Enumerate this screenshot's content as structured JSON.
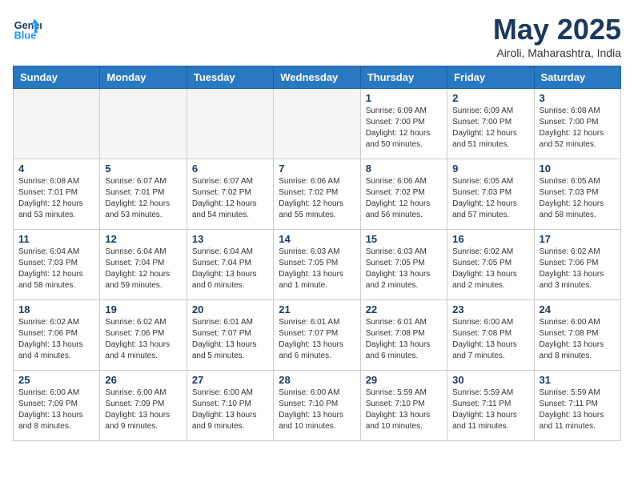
{
  "header": {
    "logo_line1": "General",
    "logo_line2": "Blue",
    "month": "May 2025",
    "location": "Airoli, Maharashtra, India"
  },
  "weekdays": [
    "Sunday",
    "Monday",
    "Tuesday",
    "Wednesday",
    "Thursday",
    "Friday",
    "Saturday"
  ],
  "weeks": [
    [
      {
        "day": "",
        "empty": true
      },
      {
        "day": "",
        "empty": true
      },
      {
        "day": "",
        "empty": true
      },
      {
        "day": "",
        "empty": true
      },
      {
        "day": "1",
        "info": "Sunrise: 6:09 AM\nSunset: 7:00 PM\nDaylight: 12 hours\nand 50 minutes."
      },
      {
        "day": "2",
        "info": "Sunrise: 6:09 AM\nSunset: 7:00 PM\nDaylight: 12 hours\nand 51 minutes."
      },
      {
        "day": "3",
        "info": "Sunrise: 6:08 AM\nSunset: 7:00 PM\nDaylight: 12 hours\nand 52 minutes."
      }
    ],
    [
      {
        "day": "4",
        "info": "Sunrise: 6:08 AM\nSunset: 7:01 PM\nDaylight: 12 hours\nand 53 minutes."
      },
      {
        "day": "5",
        "info": "Sunrise: 6:07 AM\nSunset: 7:01 PM\nDaylight: 12 hours\nand 53 minutes."
      },
      {
        "day": "6",
        "info": "Sunrise: 6:07 AM\nSunset: 7:02 PM\nDaylight: 12 hours\nand 54 minutes."
      },
      {
        "day": "7",
        "info": "Sunrise: 6:06 AM\nSunset: 7:02 PM\nDaylight: 12 hours\nand 55 minutes."
      },
      {
        "day": "8",
        "info": "Sunrise: 6:06 AM\nSunset: 7:02 PM\nDaylight: 12 hours\nand 56 minutes."
      },
      {
        "day": "9",
        "info": "Sunrise: 6:05 AM\nSunset: 7:03 PM\nDaylight: 12 hours\nand 57 minutes."
      },
      {
        "day": "10",
        "info": "Sunrise: 6:05 AM\nSunset: 7:03 PM\nDaylight: 12 hours\nand 58 minutes."
      }
    ],
    [
      {
        "day": "11",
        "info": "Sunrise: 6:04 AM\nSunset: 7:03 PM\nDaylight: 12 hours\nand 58 minutes."
      },
      {
        "day": "12",
        "info": "Sunrise: 6:04 AM\nSunset: 7:04 PM\nDaylight: 12 hours\nand 59 minutes."
      },
      {
        "day": "13",
        "info": "Sunrise: 6:04 AM\nSunset: 7:04 PM\nDaylight: 13 hours\nand 0 minutes."
      },
      {
        "day": "14",
        "info": "Sunrise: 6:03 AM\nSunset: 7:05 PM\nDaylight: 13 hours\nand 1 minute."
      },
      {
        "day": "15",
        "info": "Sunrise: 6:03 AM\nSunset: 7:05 PM\nDaylight: 13 hours\nand 2 minutes."
      },
      {
        "day": "16",
        "info": "Sunrise: 6:02 AM\nSunset: 7:05 PM\nDaylight: 13 hours\nand 2 minutes."
      },
      {
        "day": "17",
        "info": "Sunrise: 6:02 AM\nSunset: 7:06 PM\nDaylight: 13 hours\nand 3 minutes."
      }
    ],
    [
      {
        "day": "18",
        "info": "Sunrise: 6:02 AM\nSunset: 7:06 PM\nDaylight: 13 hours\nand 4 minutes."
      },
      {
        "day": "19",
        "info": "Sunrise: 6:02 AM\nSunset: 7:06 PM\nDaylight: 13 hours\nand 4 minutes."
      },
      {
        "day": "20",
        "info": "Sunrise: 6:01 AM\nSunset: 7:07 PM\nDaylight: 13 hours\nand 5 minutes."
      },
      {
        "day": "21",
        "info": "Sunrise: 6:01 AM\nSunset: 7:07 PM\nDaylight: 13 hours\nand 6 minutes."
      },
      {
        "day": "22",
        "info": "Sunrise: 6:01 AM\nSunset: 7:08 PM\nDaylight: 13 hours\nand 6 minutes."
      },
      {
        "day": "23",
        "info": "Sunrise: 6:00 AM\nSunset: 7:08 PM\nDaylight: 13 hours\nand 7 minutes."
      },
      {
        "day": "24",
        "info": "Sunrise: 6:00 AM\nSunset: 7:08 PM\nDaylight: 13 hours\nand 8 minutes."
      }
    ],
    [
      {
        "day": "25",
        "info": "Sunrise: 6:00 AM\nSunset: 7:09 PM\nDaylight: 13 hours\nand 8 minutes."
      },
      {
        "day": "26",
        "info": "Sunrise: 6:00 AM\nSunset: 7:09 PM\nDaylight: 13 hours\nand 9 minutes."
      },
      {
        "day": "27",
        "info": "Sunrise: 6:00 AM\nSunset: 7:10 PM\nDaylight: 13 hours\nand 9 minutes."
      },
      {
        "day": "28",
        "info": "Sunrise: 6:00 AM\nSunset: 7:10 PM\nDaylight: 13 hours\nand 10 minutes."
      },
      {
        "day": "29",
        "info": "Sunrise: 5:59 AM\nSunset: 7:10 PM\nDaylight: 13 hours\nand 10 minutes."
      },
      {
        "day": "30",
        "info": "Sunrise: 5:59 AM\nSunset: 7:11 PM\nDaylight: 13 hours\nand 11 minutes."
      },
      {
        "day": "31",
        "info": "Sunrise: 5:59 AM\nSunset: 7:11 PM\nDaylight: 13 hours\nand 11 minutes."
      }
    ]
  ]
}
